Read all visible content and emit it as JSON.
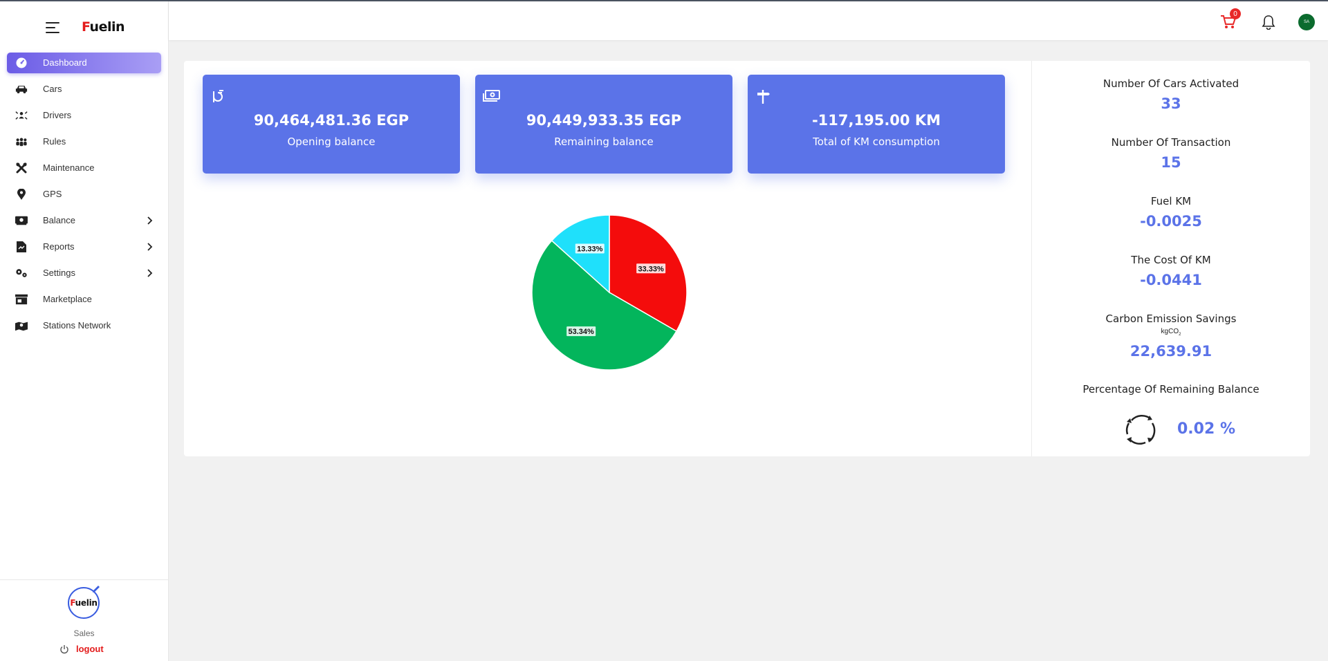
{
  "app": {
    "brand_prefix": "F",
    "brand_rest": "uelin",
    "brand_accent": "#e31b1b",
    "accent": "#5b73e8"
  },
  "sidebar": {
    "items": [
      {
        "label": "Dashboard",
        "icon": "dashboard-icon",
        "active": true
      },
      {
        "label": "Cars",
        "icon": "car-icon"
      },
      {
        "label": "Drivers",
        "icon": "drivers-icon"
      },
      {
        "label": "Rules",
        "icon": "users-group-icon"
      },
      {
        "label": "Maintenance",
        "icon": "tools-icon"
      },
      {
        "label": "GPS",
        "icon": "map-pin-icon"
      },
      {
        "label": "Balance",
        "icon": "money-icon",
        "expandable": true
      },
      {
        "label": "Reports",
        "icon": "report-file-icon",
        "expandable": true
      },
      {
        "label": "Settings",
        "icon": "gears-icon",
        "expandable": true
      },
      {
        "label": "Marketplace",
        "icon": "store-icon"
      },
      {
        "label": "Stations Network",
        "icon": "map-network-icon"
      }
    ],
    "footer": {
      "avatar_text": "Fuelin",
      "role": "Sales",
      "logout_label": "logout"
    }
  },
  "topbar": {
    "cart_count": "0",
    "flag_text": "SA"
  },
  "cards": [
    {
      "amount": "90,464,481.36 EGP",
      "label": "Opening balance",
      "icon": "fuel-nozzle-icon"
    },
    {
      "amount": "90,449,933.35 EGP",
      "label": "Remaining balance",
      "icon": "cash-icon"
    },
    {
      "amount": "-117,195.00 KM",
      "label": "Total of KM consumption",
      "icon": "signpost-icon"
    }
  ],
  "chart_data": {
    "type": "pie",
    "slices": [
      {
        "label": "33.33%",
        "value": 33.33,
        "color": "#f40c0c"
      },
      {
        "label": "53.34%",
        "value": 53.34,
        "color": "#03b55c"
      },
      {
        "label": "13.33%",
        "value": 13.33,
        "color": "#1fe0fb"
      }
    ]
  },
  "stats": {
    "cars_label": "Number Of Cars Activated",
    "cars_value": "33",
    "trans_label": "Number Of Transaction",
    "trans_value": "15",
    "fuelkm_label": "Fuel KM",
    "fuelkm_value": "-0.0025",
    "costkm_label": "The Cost Of KM",
    "costkm_value": "-0.0441",
    "carbon_label": "Carbon Emission Savings",
    "carbon_unit": "kgCO",
    "carbon_unit_sub": "2",
    "carbon_value": "22,639.91",
    "pct_label": "Percentage Of Remaining Balance",
    "pct_value": "0.02 %"
  }
}
